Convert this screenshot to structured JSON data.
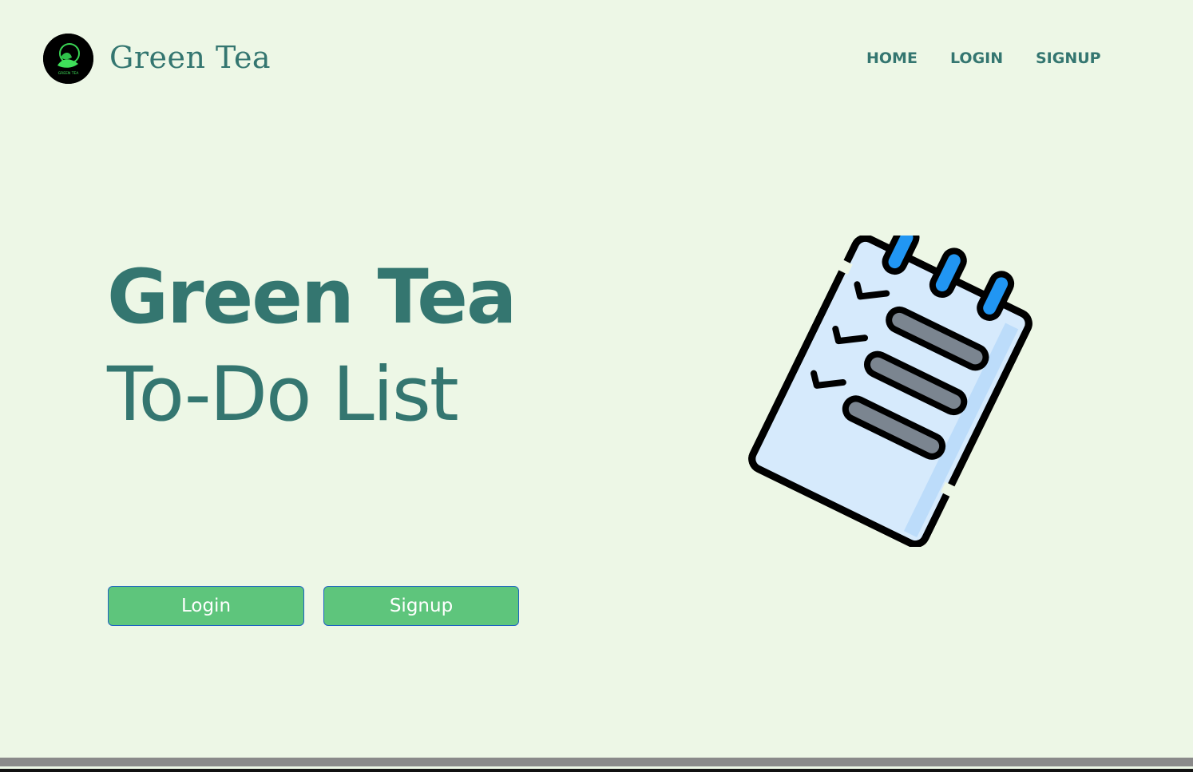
{
  "brand": {
    "name": "Green Tea",
    "logo_text": "GREEN TEA",
    "logo_icon": "tea-leaf-icon"
  },
  "nav": {
    "items": [
      {
        "label": "HOME"
      },
      {
        "label": "LOGIN"
      },
      {
        "label": "SIGNUP"
      }
    ]
  },
  "hero": {
    "title": "Green Tea",
    "subtitle": "To-Do List"
  },
  "actions": {
    "login_label": "Login",
    "signup_label": "Signup"
  },
  "illustration": {
    "icon": "notepad-checklist-icon"
  },
  "colors": {
    "background": "#edf7e6",
    "brand_teal": "#347670",
    "button_green": "#5ec57c",
    "button_border": "#1f63c2",
    "ring_blue": "#2196f3",
    "paper_blue": "#d6eafc"
  }
}
